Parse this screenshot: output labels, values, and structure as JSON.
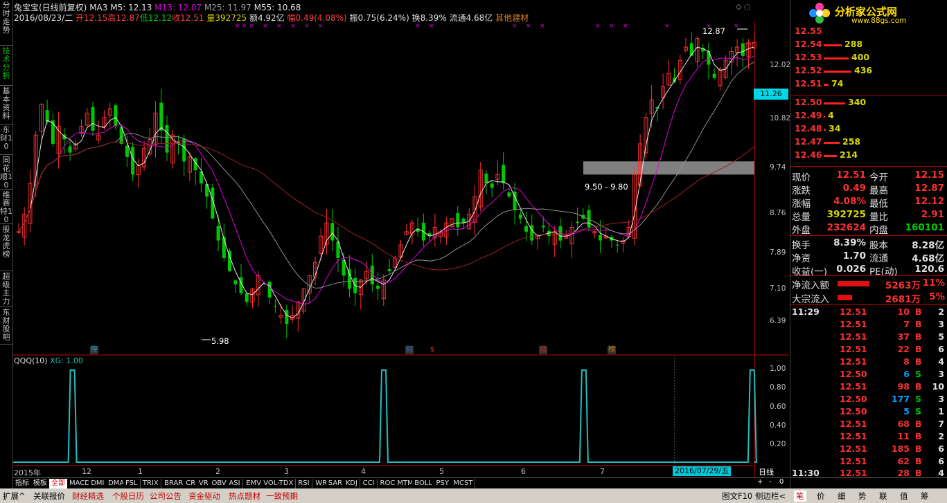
{
  "header": {
    "stock_name": "兔宝宝(日线前复权)",
    "ma_label": "MA3",
    "m5": "M5: 12.13",
    "m13": "M13: 12.07",
    "m25": "M25: 11.97",
    "m55": "M55: 10.68",
    "date": "2016/08/23/二",
    "open": "开12.15",
    "high": "高12.87",
    "low": "低12.12",
    "close": "收12.51",
    "volume": "量392725",
    "amount": "额4.92亿",
    "change_pct": "幅0.49(4.08%)",
    "amplitude": "振0.75(6.24%)",
    "turnover": "换8.39%",
    "float_cap": "流通4.68亿",
    "sector": "其他建材"
  },
  "left_tabs": [
    {
      "label": "分时走势",
      "active": false
    },
    {
      "label": "技术分析",
      "active": true
    },
    {
      "label": "基本资料",
      "active": false
    },
    {
      "label": "东财10",
      "active": false
    },
    {
      "label": "同花顺10",
      "active": false
    },
    {
      "label": "维赛特10",
      "active": false
    },
    {
      "label": "股龙虎榜",
      "active": false
    },
    {
      "label": "超级主力",
      "active": false
    },
    {
      "label": "东财股吧",
      "active": false
    }
  ],
  "chart_labels": {
    "max_price": "12.87",
    "min_price": "5.98",
    "band_range": "9.50 - 9.80",
    "current_price_tag": "11.26",
    "indicator_title": "QQQ(10)",
    "indicator_xg": "XG: 1.00",
    "cursor_date": "2016/07/29/五",
    "period": "日线",
    "events": [
      "停",
      "财",
      "$",
      "增",
      "榜"
    ]
  },
  "price_axis": [
    "12.02",
    "10.82",
    "9.74",
    "8.76",
    "7.89",
    "7.10",
    "6.39"
  ],
  "indicator_axis": [
    "1.00",
    "0.80",
    "0.60",
    "0.40",
    "0.20"
  ],
  "time_axis": [
    "2015年",
    "12",
    "1",
    "2",
    "3",
    "4",
    "5",
    "6",
    "7"
  ],
  "chart_data": {
    "type": "candlestick",
    "ylim": [
      5.6,
      13.0
    ],
    "markers": {
      "high": 12.87,
      "low": 5.98
    },
    "band": [
      9.5,
      9.8
    ],
    "closes": [
      8.2,
      8.6,
      9.3,
      10.4,
      11.1,
      10.7,
      10.2,
      10.6,
      10.3,
      10.0,
      10.2,
      10.6,
      10.9,
      10.5,
      10.4,
      10.8,
      11.0,
      10.6,
      10.2,
      9.9,
      9.5,
      9.7,
      10.1,
      10.3,
      10.9,
      10.5,
      10.0,
      10.4,
      10.2,
      9.8,
      9.9,
      9.6,
      9.3,
      9.0,
      8.5,
      8.0,
      7.6,
      7.3,
      7.0,
      6.8,
      6.6,
      6.9,
      7.2,
      7.0,
      6.7,
      6.5,
      6.3,
      6.1,
      6.3,
      6.6,
      6.9,
      7.2,
      7.5,
      8.1,
      8.4,
      8.0,
      7.6,
      7.2,
      6.9,
      6.8,
      7.1,
      7.3,
      7.0,
      6.9,
      7.1,
      7.3,
      7.6,
      7.9,
      8.2,
      8.4,
      8.2,
      8.0,
      8.1,
      8.3,
      8.2,
      8.4,
      8.5,
      8.3,
      8.4,
      8.6,
      9.0,
      9.6,
      9.3,
      9.2,
      9.5,
      9.3,
      9.0,
      8.7,
      8.5,
      8.2,
      8.0,
      8.1,
      8.3,
      8.1,
      8.2,
      8.0,
      8.1,
      8.3,
      8.4,
      8.5,
      8.3,
      8.2,
      8.0,
      8.1,
      8.0,
      7.9,
      8.0,
      8.3,
      9.5,
      10.2,
      10.8,
      11.2,
      11.0,
      11.5,
      11.8,
      11.6,
      12.1,
      12.4,
      12.2,
      12.6,
      12.3,
      12.0,
      11.7,
      11.9,
      12.1,
      12.3,
      12.4,
      12.2,
      12.5,
      12.51
    ],
    "qqq_spikes": [
      0.08,
      0.5,
      0.77,
      0.997
    ],
    "cursor_x_fraction": 0.84
  },
  "order_book": {
    "asks": [
      {
        "price": "12.55",
        "vol": ""
      },
      {
        "price": "12.54",
        "vol": "288"
      },
      {
        "price": "12.53",
        "vol": "400"
      },
      {
        "price": "12.52",
        "vol": "436"
      },
      {
        "price": "12.51",
        "vol": "74"
      }
    ],
    "bids": [
      {
        "price": "12.50",
        "vol": "340"
      },
      {
        "price": "12.49",
        "vol": "4"
      },
      {
        "price": "12.48",
        "vol": "34"
      },
      {
        "price": "12.47",
        "vol": "258"
      },
      {
        "price": "12.46",
        "vol": "214"
      }
    ],
    "bar_max": 440
  },
  "logo": {
    "brand": "分析家公式网",
    "url": "www.88gs.com"
  },
  "stats": [
    {
      "k1": "现价",
      "v1": "12.51",
      "k2": "今开",
      "v2": "12.15",
      "c1": "red",
      "c2": "red"
    },
    {
      "k1": "涨跌",
      "v1": "0.49",
      "k2": "最高",
      "v2": "12.87",
      "c1": "red",
      "c2": "red"
    },
    {
      "k1": "涨幅",
      "v1": "4.08%",
      "k2": "最低",
      "v2": "12.12",
      "c1": "red",
      "c2": "red"
    },
    {
      "k1": "总量",
      "v1": "392725",
      "k2": "量比",
      "v2": "2.91",
      "c1": "yellow",
      "c2": "red"
    },
    {
      "k1": "外盘",
      "v1": "232624",
      "k2": "内盘",
      "v2": "160101",
      "c1": "red",
      "c2": "green"
    },
    {
      "k1": "换手",
      "v1": "8.39%",
      "k2": "股本",
      "v2": "8.28亿",
      "c1": "white",
      "c2": "white"
    },
    {
      "k1": "净资",
      "v1": "1.70",
      "k2": "流通",
      "v2": "4.68亿",
      "c1": "white",
      "c2": "white"
    },
    {
      "k1": "收益(一)",
      "v1": "0.026",
      "k2": "PE(动)",
      "v2": "120.6",
      "c1": "white",
      "c2": "white"
    }
  ],
  "flows": [
    {
      "label": "净流入额",
      "value": "5263万",
      "pct": "11%",
      "ratio": 0.11
    },
    {
      "label": "大宗流入",
      "value": "2681万",
      "pct": "5%",
      "ratio": 0.05
    }
  ],
  "ticks": [
    {
      "time": "11:29",
      "price": "12.51",
      "vol": "10",
      "side": "B",
      "cnt": "2"
    },
    {
      "time": "",
      "price": "12.51",
      "vol": "7",
      "side": "B",
      "cnt": "3"
    },
    {
      "time": "",
      "price": "12.51",
      "vol": "37",
      "side": "B",
      "cnt": "5"
    },
    {
      "time": "",
      "price": "12.51",
      "vol": "22",
      "side": "B",
      "cnt": "6"
    },
    {
      "time": "",
      "price": "12.51",
      "vol": "8",
      "side": "B",
      "cnt": "4"
    },
    {
      "time": "",
      "price": "12.50",
      "vol": "6",
      "side": "S",
      "cnt": "3"
    },
    {
      "time": "",
      "price": "12.51",
      "vol": "98",
      "side": "B",
      "cnt": "10"
    },
    {
      "time": "",
      "price": "12.50",
      "vol": "177",
      "side": "S",
      "cnt": "3"
    },
    {
      "time": "",
      "price": "12.50",
      "vol": "5",
      "side": "S",
      "cnt": "1"
    },
    {
      "time": "",
      "price": "12.51",
      "vol": "68",
      "side": "B",
      "cnt": "7"
    },
    {
      "time": "",
      "price": "12.51",
      "vol": "11",
      "side": "B",
      "cnt": "2"
    },
    {
      "time": "",
      "price": "12.51",
      "vol": "185",
      "side": "B",
      "cnt": "6"
    },
    {
      "time": "",
      "price": "12.51",
      "vol": "62",
      "side": "B",
      "cnt": "6"
    },
    {
      "time": "11:30",
      "price": "12.51",
      "vol": "28",
      "side": "B",
      "cnt": "4"
    }
  ],
  "indicator_tabs": [
    "指标",
    "模板",
    "全部",
    "MACD",
    "DMI",
    "DMA",
    "FSL",
    "TRIX",
    "BRAR",
    "CR",
    "VR",
    "OBV",
    "ASI",
    "EMV",
    "VOL-TDX",
    "RSI",
    "WR",
    "SAR",
    "KDJ",
    "CCI",
    "ROC",
    "MTM",
    "BOLL",
    "PSY",
    "MCST"
  ],
  "bottom_tabs": [
    "扩展^",
    "关联报价",
    "财经精选",
    "个股日历",
    "公司公告",
    "资金驱动",
    "热点题材",
    "一致预期"
  ],
  "bottom_right": [
    "图文F10",
    "侧边栏<"
  ],
  "bottom_right_tabs": [
    "笔",
    "价",
    "细",
    "势",
    "联",
    "值",
    "筹"
  ],
  "zoom_controls": [
    "+",
    "-",
    "0"
  ],
  "colors": {
    "red": "#ff3030",
    "green": "#00c800",
    "cyan": "#20c0c0",
    "yellow": "#d8d800",
    "magenta": "#e000e0"
  }
}
